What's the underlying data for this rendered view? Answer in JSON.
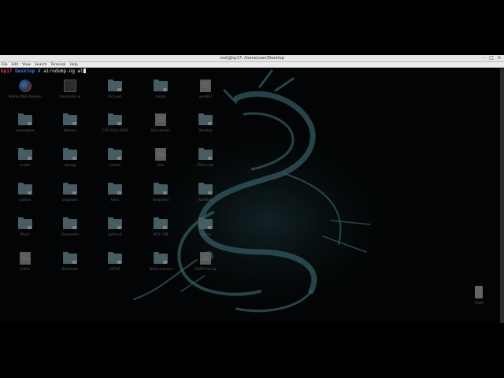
{
  "window": {
    "title": "root@hp17: /home/user/Desktop",
    "controls": [
      "–",
      "□",
      "×"
    ]
  },
  "menu": [
    "File",
    "Edit",
    "View",
    "Search",
    "Terminal",
    "Help"
  ],
  "terminal": {
    "host": "hp17",
    "dir": "Desktop",
    "symbol": "#",
    "command": "airodump-ng wl"
  },
  "desktop": {
    "icons": [
      {
        "label": "Firefox Web Browser",
        "kind": "browser"
      },
      {
        "label": "terminator.el",
        "kind": "app"
      },
      {
        "label": "Pictures",
        "kind": "folder"
      },
      {
        "label": "install",
        "kind": "folder"
      },
      {
        "label": "wordlist",
        "kind": "file"
      },
      {
        "label": "mymodules",
        "kind": "folder"
      },
      {
        "label": "Wpscan",
        "kind": "folder"
      },
      {
        "label": "CVE-2014-0160",
        "kind": "folder"
      },
      {
        "label": "Documents",
        "kind": "file"
      },
      {
        "label": "Desktop",
        "kind": "folder"
      },
      {
        "label": "scripts",
        "kind": "folder"
      },
      {
        "label": "sqlmap",
        "kind": "folder"
      },
      {
        "label": "exploit",
        "kind": "folder"
      },
      {
        "label": "test",
        "kind": "file"
      },
      {
        "label": "ITSecurity",
        "kind": "folder"
      },
      {
        "label": "python",
        "kind": "folder"
      },
      {
        "label": "programs",
        "kind": "folder"
      },
      {
        "label": "tools",
        "kind": "folder"
      },
      {
        "label": "Templates",
        "kind": "folder"
      },
      {
        "label": "wordlists",
        "kind": "folder"
      },
      {
        "label": "Music",
        "kind": "folder"
      },
      {
        "label": "Downloads",
        "kind": "folder"
      },
      {
        "label": "python3",
        "kind": "folder"
      },
      {
        "label": "WIFI CUB",
        "kind": "folder"
      },
      {
        "label": "Videos",
        "kind": "folder"
      },
      {
        "label": "Public",
        "kind": "file"
      },
      {
        "label": "Bluetooth",
        "kind": "folder"
      },
      {
        "label": "SETUP",
        "kind": "folder"
      },
      {
        "label": "Wash scanner",
        "kind": "folder"
      },
      {
        "label": "SOAP-01.cap",
        "kind": "file"
      },
      {
        "label": "Trash",
        "kind": "trash"
      }
    ]
  }
}
